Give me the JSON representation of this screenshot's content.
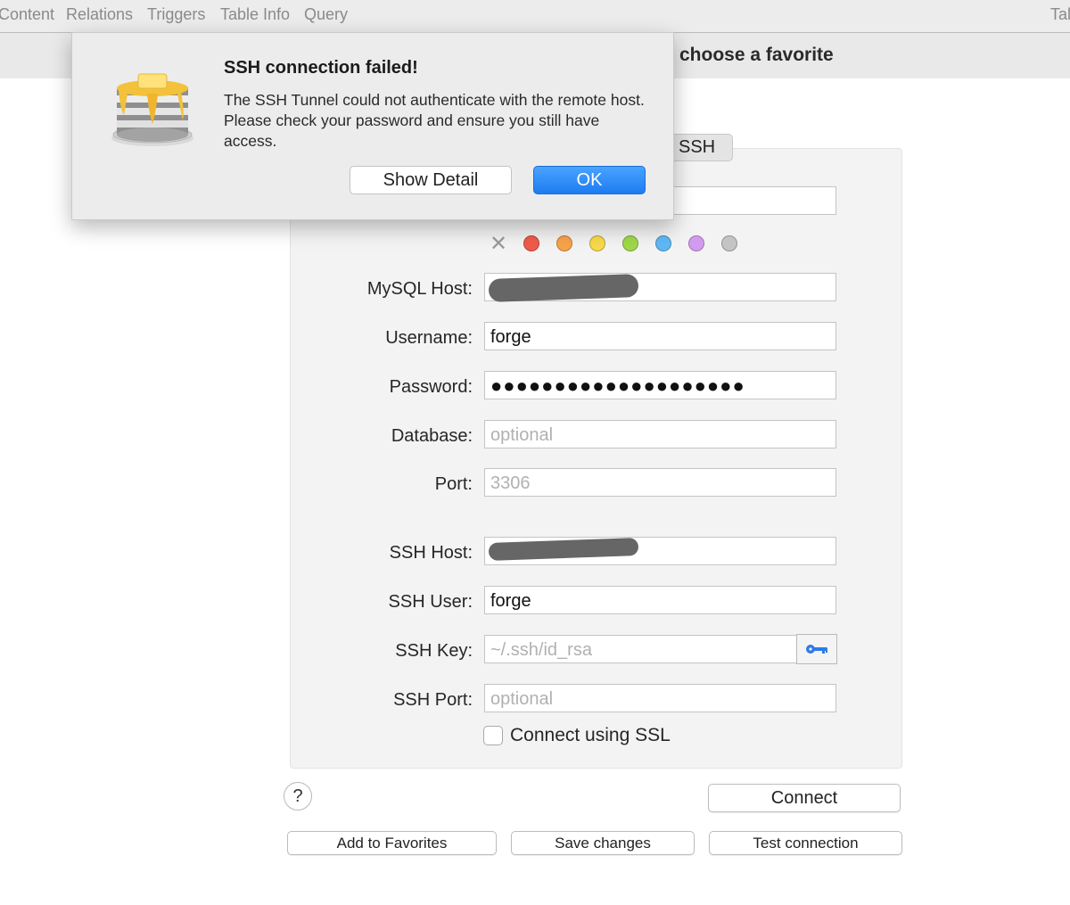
{
  "tabs": [
    "Content",
    "Relations",
    "Triggers",
    "Table Info",
    "Query",
    "Tal"
  ],
  "header": {
    "title": "choose a favorite"
  },
  "connection_tab": "SSH",
  "colors": {
    "favorite_tags": [
      "#f05b4b",
      "#f7a34a",
      "#f7d94a",
      "#9fd84a",
      "#5fb8f5",
      "#d39bf0",
      "#c4c4c4"
    ],
    "accent": "#1d7cf2"
  },
  "form": {
    "mysql_host": {
      "label": "MySQL Host:",
      "value": ""
    },
    "username": {
      "label": "Username:",
      "value": "forge"
    },
    "password": {
      "label": "Password:",
      "value": "●●●●●●●●●●●●●●●●●●●●"
    },
    "database": {
      "label": "Database:",
      "placeholder": "optional"
    },
    "port": {
      "label": "Port:",
      "placeholder": "3306"
    },
    "ssh_host": {
      "label": "SSH Host:",
      "value": ""
    },
    "ssh_user": {
      "label": "SSH User:",
      "value": "forge"
    },
    "ssh_key": {
      "label": "SSH Key:",
      "placeholder": "~/.ssh/id_rsa"
    },
    "ssh_port": {
      "label": "SSH Port:",
      "placeholder": "optional"
    },
    "ssl_label": "Connect using SSL"
  },
  "buttons": {
    "help": "?",
    "connect": "Connect",
    "add_favorites": "Add to Favorites",
    "save_changes": "Save changes",
    "test_connection": "Test connection"
  },
  "alert": {
    "title": "SSH connection failed!",
    "message": "The SSH Tunnel could not authenticate with the remote host. Please check your password and ensure you still have access.",
    "show_detail": "Show Detail",
    "ok": "OK"
  },
  "icons": {
    "app": "sequel-pro-pancake-icon",
    "clear_tag": "x-icon",
    "ssh_key_picker": "key-icon"
  }
}
